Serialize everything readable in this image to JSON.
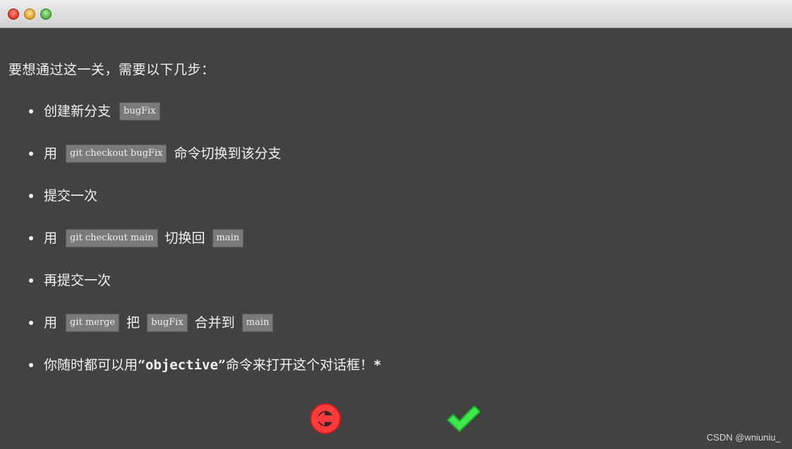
{
  "window": {
    "controls": [
      "close",
      "minimize",
      "zoom"
    ]
  },
  "dialog": {
    "intro": "要想通过这一关，需要以下几步：",
    "steps": [
      {
        "text_before": "创建新分支",
        "code1": "bugFix"
      },
      {
        "text_before": "用",
        "code1": "git checkout bugFix",
        "text_after": "命令切换到该分支"
      },
      {
        "text_before": "提交一次"
      },
      {
        "text_before": "用",
        "code1": "git checkout main",
        "text_middle": "切换回",
        "code2": "main"
      },
      {
        "text_before": "再提交一次"
      },
      {
        "text_before": "用",
        "code1": "git merge",
        "text_middle": "把",
        "code2": "bugFix",
        "text_middle2": "合并到",
        "code3": "main"
      },
      {
        "text_before": "你随时都可以用",
        "quote_open": "“",
        "keyword": "objective",
        "quote_close": "”",
        "text_after": "命令来打开这个对话框！",
        "asterisk": "*"
      }
    ]
  },
  "buttons": {
    "back_icon": "left-arrow-circle-icon",
    "back_color": "#ff3b3b",
    "confirm_icon": "checkmark-icon",
    "confirm_color": "#3ee74a"
  },
  "watermark": "CSDN @wniuniu_"
}
